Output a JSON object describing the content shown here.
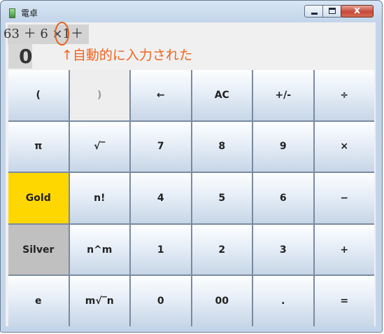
{
  "window": {
    "title": "電卓",
    "close_glyph": "x"
  },
  "display": {
    "expression_prefix": "63 ＋ 6 ×",
    "expression_highlight": "1",
    "expression_suffix": "＋",
    "value": "0",
    "annotation": "↑自動的に入力された"
  },
  "colors": {
    "annotation": "#f0641e",
    "gold_key": "#ffd700",
    "silver_key": "#c0c0c0"
  },
  "keypad": {
    "rows": [
      [
        "(",
        ")",
        "←",
        "AC",
        "+/-",
        "÷"
      ],
      [
        "π",
        "√‾",
        "7",
        "8",
        "9",
        "×"
      ],
      [
        "Gold",
        "n!",
        "4",
        "5",
        "6",
        "−"
      ],
      [
        "Silver",
        "n^m",
        "1",
        "2",
        "3",
        "+"
      ],
      [
        "e",
        "m√‾n",
        "0",
        "00",
        ".",
        "="
      ]
    ]
  }
}
